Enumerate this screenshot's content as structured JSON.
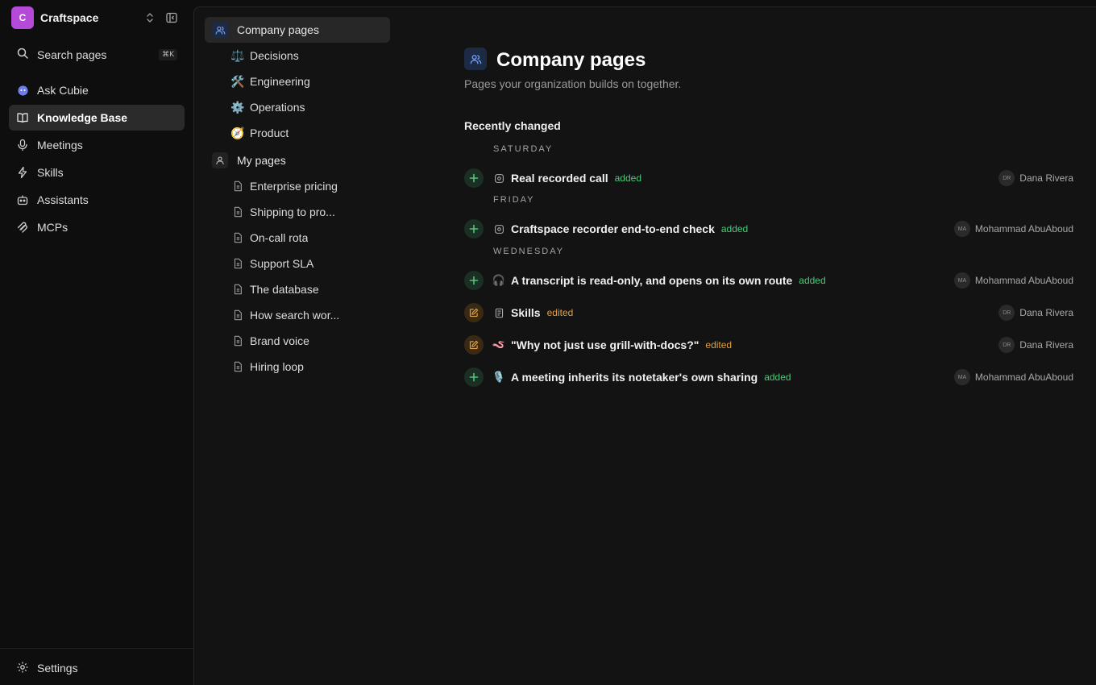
{
  "workspace": {
    "initial": "C",
    "name": "Craftspace",
    "accent": "#b54ad9"
  },
  "search": {
    "label": "Search pages",
    "shortcut": "⌘K"
  },
  "nav": {
    "items": [
      {
        "label": "Ask Cubie",
        "icon": "cubie-icon"
      },
      {
        "label": "Knowledge Base",
        "icon": "book-icon",
        "active": true
      },
      {
        "label": "Meetings",
        "icon": "microphone-icon"
      },
      {
        "label": "Skills",
        "icon": "bolt-icon"
      },
      {
        "label": "Assistants",
        "icon": "bot-icon"
      },
      {
        "label": "MCPs",
        "icon": "mcp-icon"
      }
    ]
  },
  "settings": {
    "label": "Settings"
  },
  "tree": {
    "company": {
      "label": "Company pages",
      "children": [
        {
          "icon": "⚖️",
          "label": "Decisions"
        },
        {
          "icon": "🛠️",
          "label": "Engineering"
        },
        {
          "icon": "⚙️",
          "label": "Operations"
        },
        {
          "icon": "🧭",
          "label": "Product"
        }
      ]
    },
    "mine": {
      "label": "My pages",
      "children": [
        {
          "label": "Enterprise pricing"
        },
        {
          "label": "Shipping to pro..."
        },
        {
          "label": "On-call rota"
        },
        {
          "label": "Support SLA"
        },
        {
          "label": "The database"
        },
        {
          "label": "How search wor..."
        },
        {
          "label": "Brand voice"
        },
        {
          "label": "Hiring loop"
        }
      ]
    }
  },
  "main": {
    "title": "Company pages",
    "subtitle": "Pages your organization builds on together.",
    "section_title": "Recently changed",
    "days": [
      "SATURDAY",
      "FRIDAY",
      "WEDNESDAY"
    ],
    "changes": [
      {
        "day": "SATURDAY",
        "type": "added",
        "icon": "recording-icon",
        "title": "Real recorded call",
        "status": "added",
        "author_initials": "DR",
        "author": "Dana Rivera"
      },
      {
        "day": "FRIDAY",
        "type": "added",
        "icon": "recording-icon",
        "title": "Craftspace recorder end-to-end check",
        "status": "added",
        "author_initials": "MA",
        "author": "Mohammad AbuAboud"
      },
      {
        "day": "WEDNESDAY",
        "type": "added",
        "icon": "🎧",
        "title": "A transcript is read-only, and opens on its own route",
        "status": "added",
        "author_initials": "MA",
        "author": "Mohammad AbuAboud"
      },
      {
        "day": "WEDNESDAY",
        "type": "edited",
        "icon": "document-icon",
        "title": "Skills",
        "status": "edited",
        "author_initials": "DR",
        "author": "Dana Rivera"
      },
      {
        "day": "WEDNESDAY",
        "type": "edited",
        "icon": "🪱",
        "title": "\"Why not just use grill-with-docs?\"",
        "status": "edited",
        "author_initials": "DR",
        "author": "Dana Rivera"
      },
      {
        "day": "WEDNESDAY",
        "type": "added",
        "icon": "🎙️",
        "title": "A meeting inherits its notetaker's own sharing",
        "status": "added",
        "author_initials": "MA",
        "author": "Mohammad AbuAboud"
      }
    ]
  },
  "colors": {
    "added": "#4ec97a",
    "edited": "#e0a043",
    "accent_blue": "#6f9bf0"
  }
}
